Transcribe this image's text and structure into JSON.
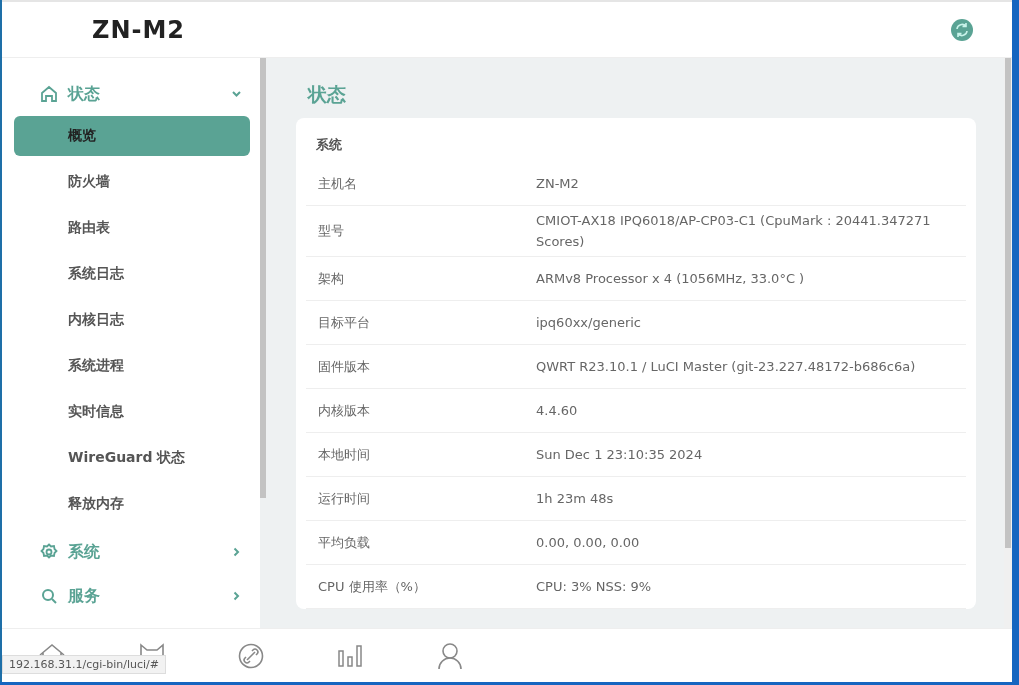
{
  "header": {
    "title": "ZN-M2"
  },
  "sidebar": {
    "groups": [
      {
        "label": "状态",
        "expanded": true,
        "children": [
          {
            "label": "概览",
            "selected": true
          },
          {
            "label": "防火墙",
            "selected": false
          },
          {
            "label": "路由表",
            "selected": false
          },
          {
            "label": "系统日志",
            "selected": false
          },
          {
            "label": "内核日志",
            "selected": false
          },
          {
            "label": "系统进程",
            "selected": false
          },
          {
            "label": "实时信息",
            "selected": false
          },
          {
            "label": "WireGuard 状态",
            "selected": false
          },
          {
            "label": "释放内存",
            "selected": false
          }
        ]
      },
      {
        "label": "系统",
        "expanded": false
      },
      {
        "label": "服务",
        "expanded": false
      }
    ]
  },
  "page_title": "状态",
  "card": {
    "title": "系统",
    "rows": [
      {
        "label": "主机名",
        "value": "ZN-M2"
      },
      {
        "label": "型号",
        "value": "CMIOT-AX18 IPQ6018/AP-CP03-C1 (CpuMark : 20441.347271 Scores)"
      },
      {
        "label": "架构",
        "value": "ARMv8 Processor x 4 (1056MHz, 33.0°C )"
      },
      {
        "label": "目标平台",
        "value": "ipq60xx/generic"
      },
      {
        "label": "固件版本",
        "value": "QWRT R23.10.1 / LuCI Master (git-23.227.48172-b686c6a)"
      },
      {
        "label": "内核版本",
        "value": "4.4.60"
      },
      {
        "label": "本地时间",
        "value": "Sun Dec 1 23:10:35 2024"
      },
      {
        "label": "运行时间",
        "value": "1h 23m 48s"
      },
      {
        "label": "平均负载",
        "value": "0.00, 0.00, 0.00"
      },
      {
        "label": "CPU 使用率（%）",
        "value": "CPU: 3% NSS: 9%"
      }
    ]
  },
  "status_url": "192.168.31.1/cgi-bin/luci/#"
}
